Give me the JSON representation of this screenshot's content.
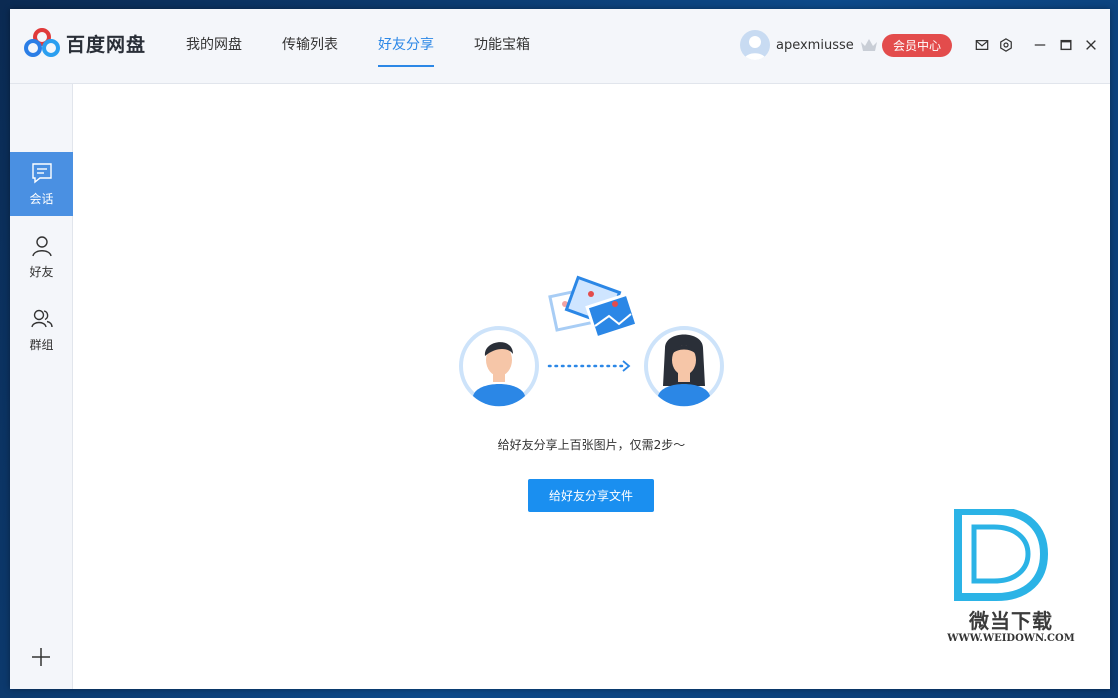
{
  "app": {
    "name": "百度网盘"
  },
  "nav": {
    "items": [
      {
        "label": "我的网盘"
      },
      {
        "label": "传输列表"
      },
      {
        "label": "好友分享"
      },
      {
        "label": "功能宝箱"
      }
    ],
    "active_index": 2
  },
  "user": {
    "name": "apexmiusse",
    "vip_label": "会员中心"
  },
  "sidebar": {
    "items": [
      {
        "label": "会话",
        "icon": "chat-icon"
      },
      {
        "label": "好友",
        "icon": "person-icon"
      },
      {
        "label": "群组",
        "icon": "group-icon"
      }
    ],
    "active_index": 0
  },
  "main": {
    "empty_text": "给好友分享上百张图片，仅需2步～",
    "share_button": "给好友分享文件"
  },
  "watermark": {
    "cn": "微当下载",
    "en": "WWW.WEIDOWN.COM"
  },
  "colors": {
    "accent": "#2b87e6",
    "vip": "#e34c4c",
    "sidebar_active": "#4a90e2",
    "button": "#1a8ff0"
  }
}
